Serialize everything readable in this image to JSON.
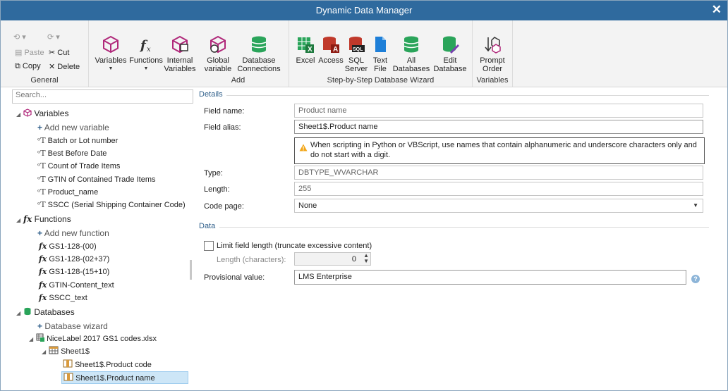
{
  "window": {
    "title": "Dynamic Data Manager",
    "close_glyph": "✕"
  },
  "ribbon": {
    "general": {
      "label": "General",
      "undo": "⟲ ▾",
      "redo": "⟳ ▾",
      "paste": "Paste",
      "cut": "Cut",
      "copy": "Copy",
      "delete": "Delete"
    },
    "add": {
      "label": "Add",
      "variables": "Variables",
      "functions": "Functions",
      "internal_variables": "Internal Variables",
      "global_variable": "Global variable",
      "database_connections": "Database Connections"
    },
    "wizard": {
      "label": "Step-by-Step Database Wizard",
      "excel": "Excel",
      "access": "Access",
      "sql_server": "SQL Server",
      "text_file": "Text File",
      "all_databases": "All Databases",
      "edit_database": "Edit Database"
    },
    "variables_group": {
      "label": "Variables",
      "prompt_order": "Prompt Order"
    }
  },
  "search": {
    "placeholder": "Search..."
  },
  "tree": {
    "variables": {
      "label": "Variables",
      "add": "Add new variable",
      "items": [
        "Batch or Lot number",
        "Best Before Date",
        "Count of Trade Items",
        "GTIN of Contained Trade Items",
        "Product_name",
        "SSCC (Serial Shipping Container Code)"
      ]
    },
    "functions": {
      "label": "Functions",
      "add": "Add new function",
      "items": [
        "GS1-128-(00)",
        "GS1-128-(02+37)",
        "GS1-128-(15+10)",
        "GTIN-Content_text",
        "SSCC_text"
      ]
    },
    "databases": {
      "label": "Databases",
      "add": "Database wizard",
      "file": "NiceLabel 2017 GS1 codes.xlsx",
      "sheet": "Sheet1$",
      "fields": [
        "Sheet1$.Product code",
        "Sheet1$.Product name"
      ]
    }
  },
  "details": {
    "section": "Details",
    "field_name_label": "Field name:",
    "field_name": "Product name",
    "field_alias_label": "Field alias:",
    "field_alias": "Sheet1$.Product name",
    "warning": "When scripting in Python or VBScript, use names that contain alphanumeric and underscore characters only and do not start with a digit.",
    "type_label": "Type:",
    "type": "DBTYPE_WVARCHAR",
    "length_label": "Length:",
    "length": "255",
    "code_page_label": "Code page:",
    "code_page": "None"
  },
  "data": {
    "section": "Data",
    "limit_label": "Limit field length (truncate excessive content)",
    "length_chars_label": "Length (characters):",
    "length_chars": "0",
    "provisional_label": "Provisional value:",
    "provisional": "LMS Enterprise"
  },
  "colors": {
    "titlebar": "#2f6a9e",
    "accent": "#2f5f8a",
    "selection": "#cde6f7"
  }
}
